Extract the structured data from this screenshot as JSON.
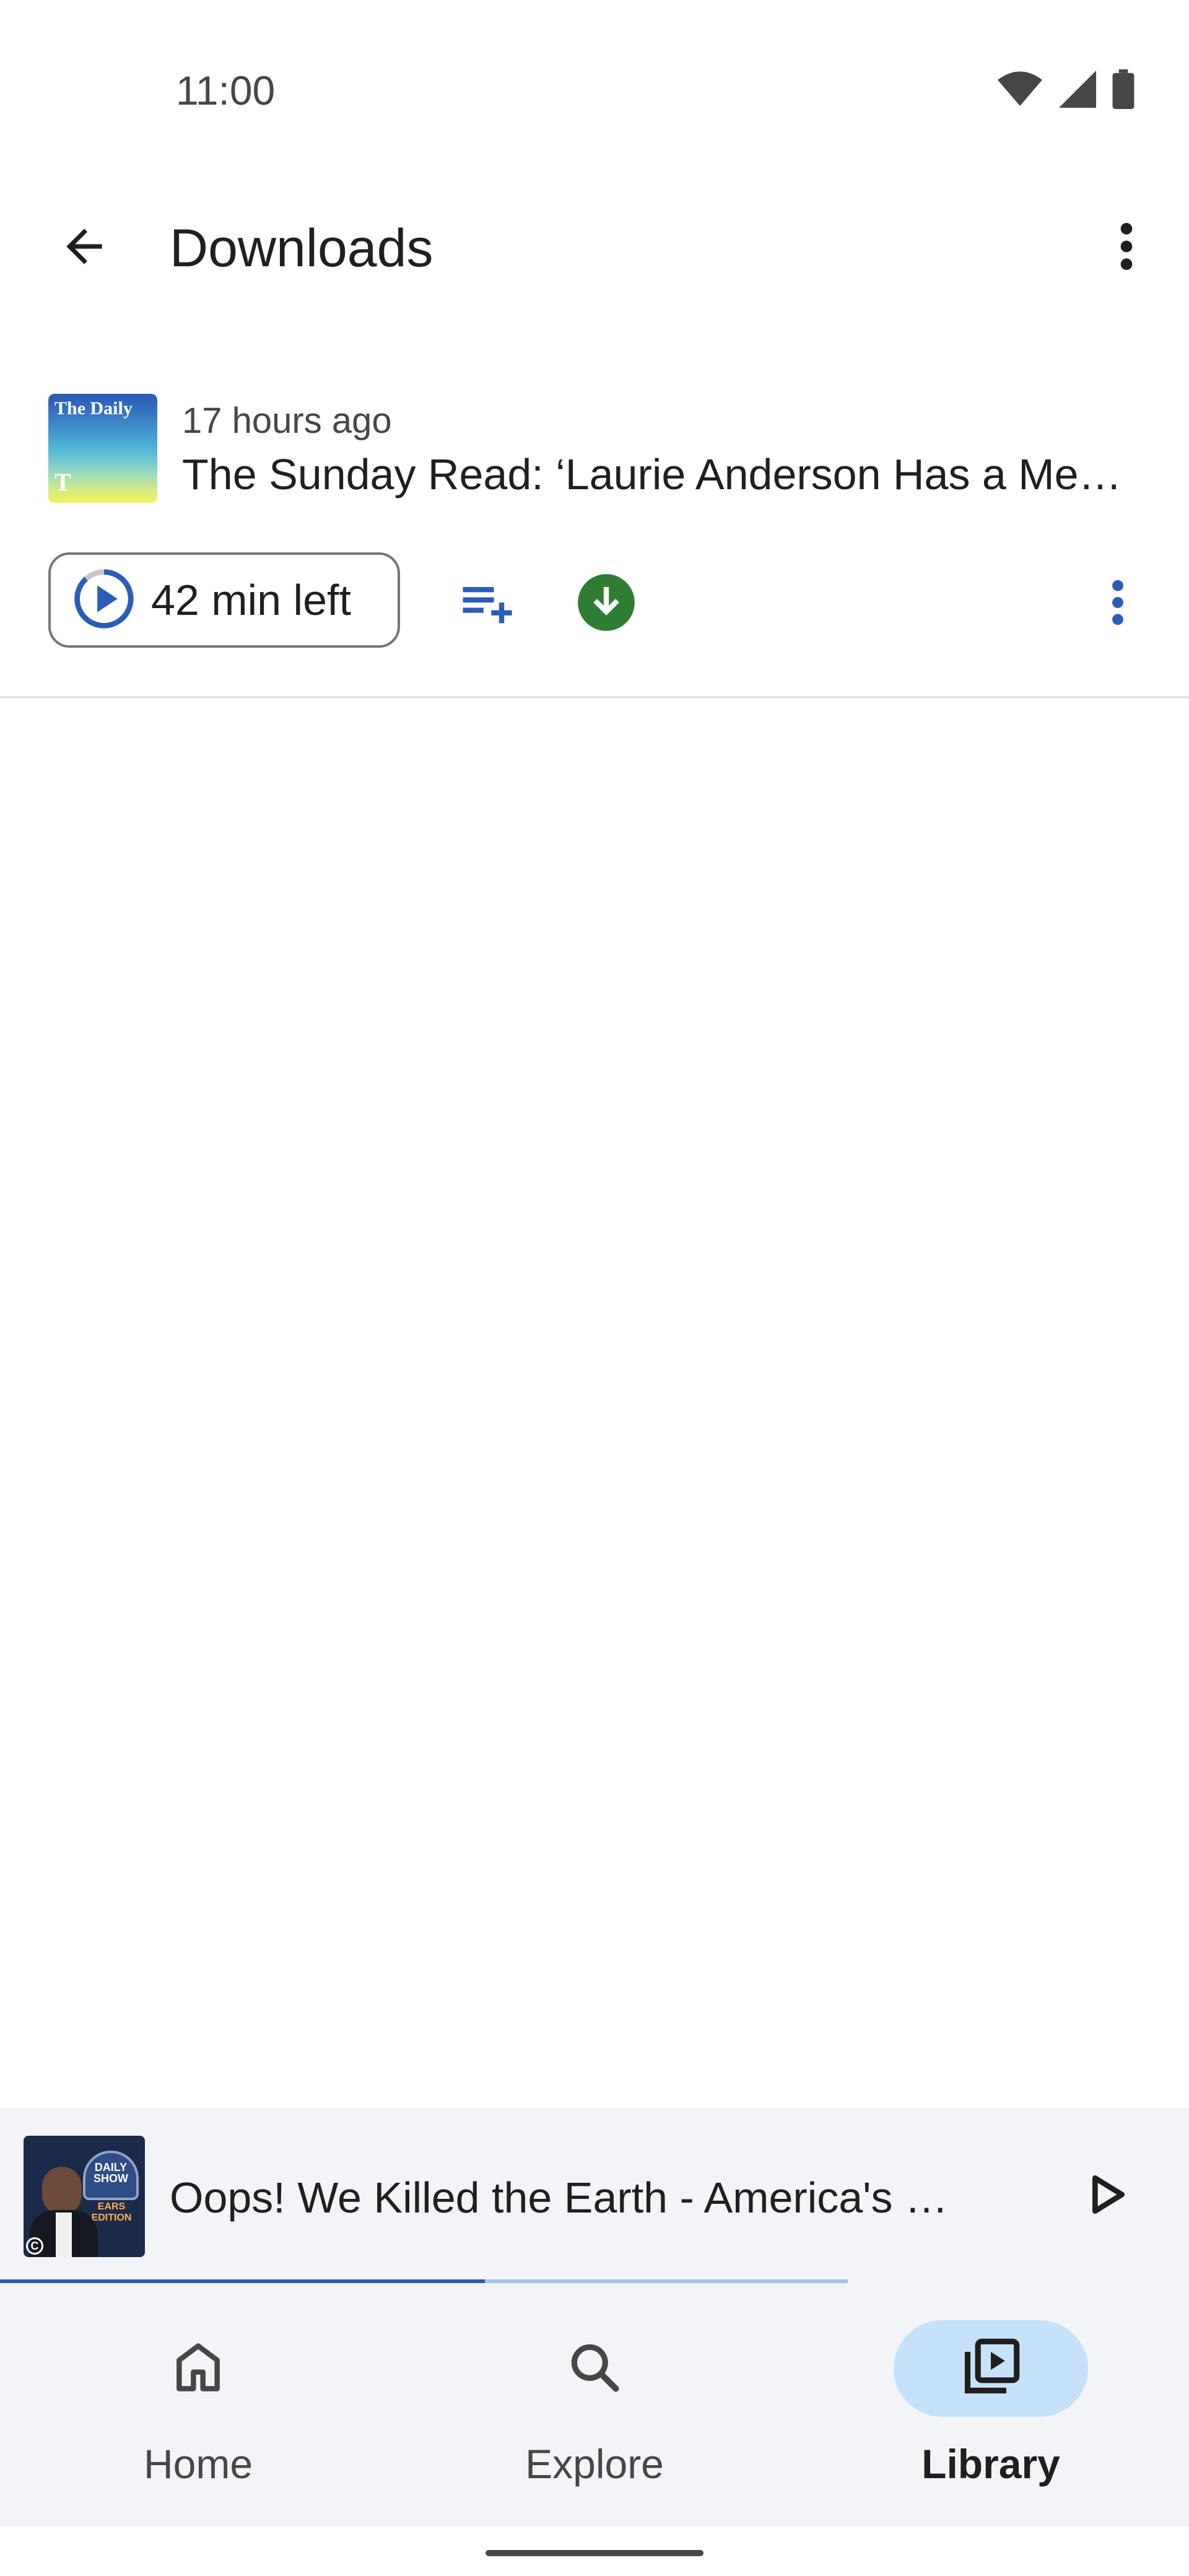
{
  "status_bar": {
    "time": "11:00",
    "icons": [
      "wifi-icon",
      "cellular-icon",
      "battery-icon"
    ]
  },
  "app_bar": {
    "title": "Downloads",
    "back_icon": "arrow-back-icon",
    "overflow_icon": "more-vert-icon"
  },
  "episodes": [
    {
      "meta": "17 hours ago",
      "title": "The Sunday Read: ‘Laurie Anderson Has a Mes…",
      "artwork_label": "The Daily",
      "artwork_logo": "T",
      "play_chip_label": "42 min left",
      "queue_icon": "playlist-add-icon",
      "download_icon": "download-done-icon",
      "more_icon": "more-vert-icon"
    }
  ],
  "mini_player": {
    "title": "Oops! We Killed the Earth - America's …",
    "artwork_show": "DAILY SHOW",
    "artwork_edition": "EARS EDITION",
    "artwork_mark": "C",
    "play_icon": "play-icon",
    "progress_fraction": 0.408,
    "buffer_fraction": 0.713
  },
  "bottom_nav": {
    "items": [
      {
        "label": "Home",
        "icon": "home-icon",
        "active": false
      },
      {
        "label": "Explore",
        "icon": "search-icon",
        "active": false
      },
      {
        "label": "Library",
        "icon": "library-icon",
        "active": true
      }
    ]
  },
  "colors": {
    "accent": "#2b5cb8",
    "download_green": "#2e7d32",
    "nav_active": "#c6e2fb",
    "surface": "#f2f4f8"
  }
}
